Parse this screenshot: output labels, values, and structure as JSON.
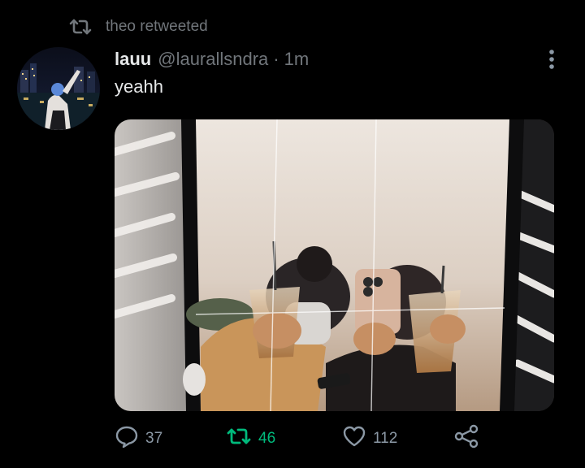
{
  "retweet_banner": {
    "text": "theo retweeted",
    "icon": "retweet-icon"
  },
  "tweet": {
    "display_name": "lauu",
    "handle": "@laurallsndra",
    "separator": "·",
    "time": "1m",
    "text": "yeahh",
    "avatar": "profile-photo-night-city",
    "media": "mirror-selfie-iced-coffee-photo"
  },
  "actions": {
    "reply": {
      "count": "37",
      "icon": "reply-icon"
    },
    "retweet": {
      "count": "46",
      "icon": "retweet-icon",
      "active": true
    },
    "like": {
      "count": "112",
      "icon": "heart-icon"
    },
    "share": {
      "icon": "share-icon"
    }
  },
  "more": {
    "icon": "more-vertical-icon"
  },
  "colors": {
    "background": "#000000",
    "text_primary": "#e7e9ea",
    "text_secondary": "#71767b",
    "retweet_active": "#00ba7c"
  }
}
